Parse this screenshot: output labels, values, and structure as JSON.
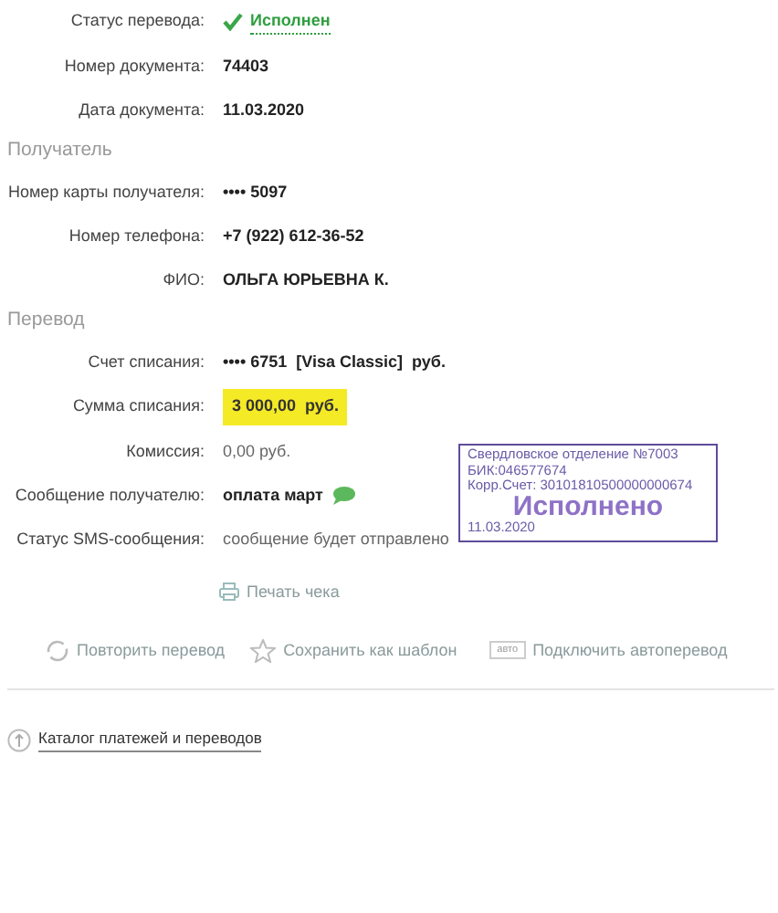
{
  "details": [
    {
      "label": "Статус перевода:",
      "value": "Исполнен",
      "kind": "status"
    },
    {
      "label": "Номер документа:",
      "value": "74403",
      "kind": "bold"
    },
    {
      "label": "Дата документа:",
      "value": "11.03.2020",
      "kind": "bold"
    }
  ],
  "recipient": {
    "heading": "Получатель",
    "rows": [
      {
        "label": "Номер карты получателя:",
        "value": "•••• 5097",
        "kind": "bold"
      },
      {
        "label": "Номер телефона:",
        "value": "+7 (922) 612-36-52",
        "kind": "bold"
      },
      {
        "label": "ФИО:",
        "value": "ОЛЬГА ЮРЬЕВНА К.",
        "kind": "bold"
      }
    ]
  },
  "transfer": {
    "heading": "Перевод",
    "rows": [
      {
        "label": "Счет списания:",
        "value": "•••• 6751  [Visa Classic]  руб.",
        "kind": "bold"
      },
      {
        "label": "Сумма списания:",
        "value": "3 000,00  руб.",
        "kind": "highlight"
      },
      {
        "label": "Комиссия:",
        "value": "0,00 руб.",
        "kind": "plain"
      },
      {
        "label": "Сообщение получателю:",
        "value": "оплата март",
        "kind": "message"
      },
      {
        "label": "Статус SMS-сообщения:",
        "value": "сообщение будет отправлено",
        "kind": "plain"
      }
    ]
  },
  "stamp": {
    "lines": [
      "Свердловское отделение №7003",
      "БИК:046577674",
      "Корр.Счет: 30101810500000000674"
    ],
    "status": "Исполнено",
    "date": "11.03.2020"
  },
  "print_link": "Печать чека",
  "actions": [
    {
      "kind": "repeat",
      "label": "Повторить перевод"
    },
    {
      "kind": "template",
      "label": "Сохранить как шаблон"
    },
    {
      "kind": "auto",
      "badge": "авто",
      "label": "Подключить автоперевод"
    }
  ],
  "catalog_link": "Каталог платежей и переводов"
}
